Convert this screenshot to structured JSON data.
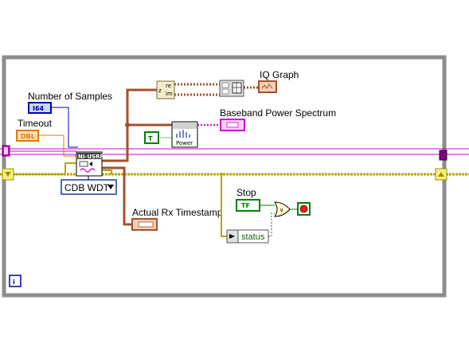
{
  "labels": {
    "number_of_samples": "Number of Samples",
    "timeout": "Timeout",
    "iq_graph": "IQ Graph",
    "baseband_power_spectrum": "Baseband Power Spectrum",
    "actual_rx_timestamp": "Actual Rx Timestamp",
    "stop": "Stop"
  },
  "terminals": {
    "number_of_samples_type": "I64",
    "timeout_type": "DBL",
    "stop_type": "TF",
    "true_constant": "T"
  },
  "nodes": {
    "niusrp_header": "NI-USRP",
    "power_label": "Power",
    "ring_value": "CDB WDT",
    "status_label": "status",
    "info_icon": "i",
    "complex_re": "re",
    "complex_im": "im",
    "complex_z": "z"
  },
  "colors": {
    "loop_border": "#8c8c8c",
    "complex_wire": "#a0522d",
    "cluster_wire": "#d400d4",
    "error_wire": "#b8a400",
    "int_wire": "#0000aa",
    "dbl_wire": "#e57a00",
    "bool_wire": "#008000"
  }
}
